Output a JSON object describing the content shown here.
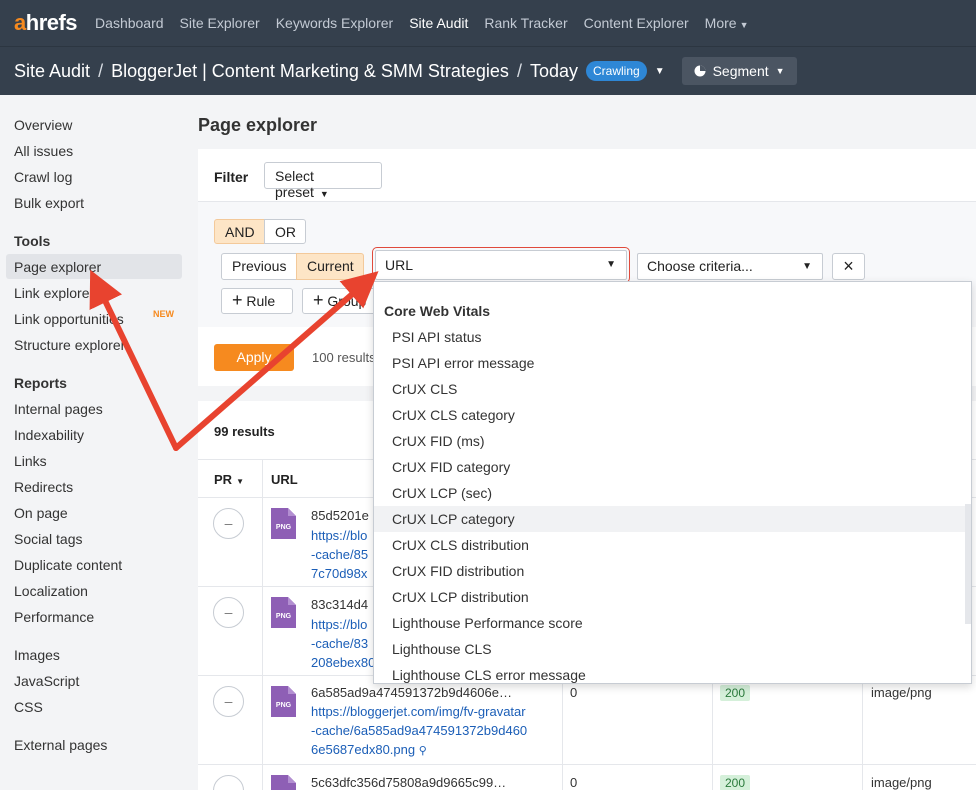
{
  "topnav": {
    "logo_a": "a",
    "logo_rest": "hrefs",
    "items": [
      "Dashboard",
      "Site Explorer",
      "Keywords Explorer",
      "Site Audit",
      "Rank Tracker",
      "Content Explorer",
      "More"
    ],
    "active": "Site Audit"
  },
  "crumbs": {
    "root": "Site Audit",
    "project": "BloggerJet | Content Marketing & SMM Strategies",
    "date": "Today",
    "status": "Crawling",
    "segment": "Segment"
  },
  "sidebar": {
    "top": [
      "Overview",
      "All issues",
      "Crawl log",
      "Bulk export"
    ],
    "tools_heading": "Tools",
    "tools": [
      "Page explorer",
      "Link explorer",
      "Link opportunities",
      "Structure explorer"
    ],
    "new_badge": "NEW",
    "reports_heading": "Reports",
    "reports": [
      "Internal pages",
      "Indexability",
      "Links",
      "Redirects",
      "On page",
      "Social tags",
      "Duplicate content",
      "Localization",
      "Performance"
    ],
    "resources": [
      "Images",
      "JavaScript",
      "CSS"
    ],
    "external": [
      "External pages"
    ]
  },
  "main": {
    "title": "Page explorer",
    "filter_label": "Filter",
    "preset": "Select preset",
    "logic": [
      "AND",
      "OR"
    ],
    "period": [
      "Previous",
      "Current"
    ],
    "field_select": "URL",
    "criteria_select": "Choose criteria...",
    "remove": "×",
    "add_rule": "Rule",
    "add_group": "Group",
    "apply": "Apply",
    "results_preview": "100 results",
    "results_title": "99 results",
    "columns": [
      "PR",
      "URL"
    ]
  },
  "rows": [
    {
      "title": "85d5201e",
      "url": [
        "https://blo",
        "-cache/85",
        "7c70d98x"
      ],
      "pr": "–"
    },
    {
      "title": "83c314d4",
      "url": [
        "https://blo",
        "-cache/83",
        "208ebex80"
      ],
      "pr": "–"
    },
    {
      "title": "6a585ad9a474591372b9d4606e…",
      "url": [
        "https://bloggerjet.com/img/fv-gravatar",
        "-cache/6a585ad9a474591372b9d460",
        "6e5687edx80.png"
      ],
      "pr": "–",
      "zero": "0",
      "status": "200",
      "type": "image/png"
    },
    {
      "title": "5c63dfc356d75808a9d9665c99…",
      "pr": "–",
      "zero": "0",
      "status": "200",
      "type": "image/png"
    }
  ],
  "icon_label": "PNG",
  "menu": {
    "heading": "Core Web Vitals",
    "items": [
      "PSI API status",
      "PSI API error message",
      "CrUX CLS",
      "CrUX CLS category",
      "CrUX FID (ms)",
      "CrUX FID category",
      "CrUX LCP (sec)",
      "CrUX LCP category",
      "CrUX CLS distribution",
      "CrUX FID distribution",
      "CrUX LCP distribution",
      "Lighthouse Performance score",
      "Lighthouse CLS",
      "Lighthouse CLS error message"
    ],
    "hovered": "CrUX LCP category"
  },
  "colors": {
    "nav": "#35404d",
    "accent": "#f68a1f",
    "link": "#1b5eb7",
    "arrow": "#e8432f",
    "crawling": "#2e87d6"
  }
}
